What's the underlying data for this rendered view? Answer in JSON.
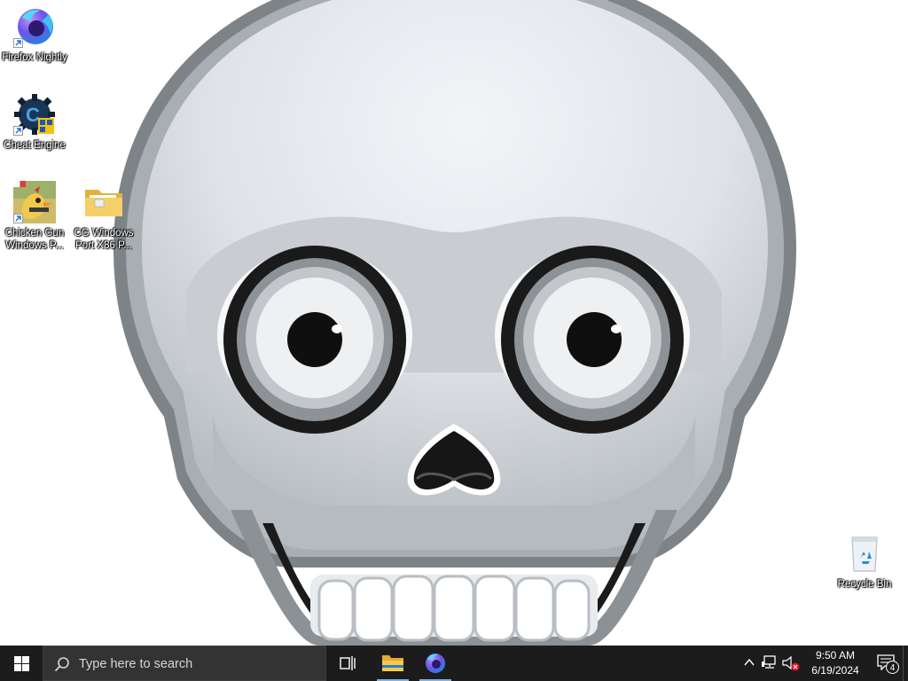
{
  "desktop": {
    "icons": [
      {
        "label": "Firefox Nightly"
      },
      {
        "label": "Cheat Engine"
      },
      {
        "label": "Chicken Gun Windows P..."
      },
      {
        "label": "CG Windows Port X86 P..."
      },
      {
        "label": "Recycle Bin"
      }
    ]
  },
  "taskbar": {
    "search_placeholder": "Type here to search",
    "pinned": [
      "task-view",
      "file-explorer",
      "firefox-nightly"
    ],
    "tray": {
      "time": "9:50 AM",
      "date": "6/19/2024",
      "notification_count": "4"
    }
  },
  "colors": {
    "taskbar_bg": "#1c1c1c",
    "search_bg": "#333333",
    "accent": "#7fb3de"
  }
}
